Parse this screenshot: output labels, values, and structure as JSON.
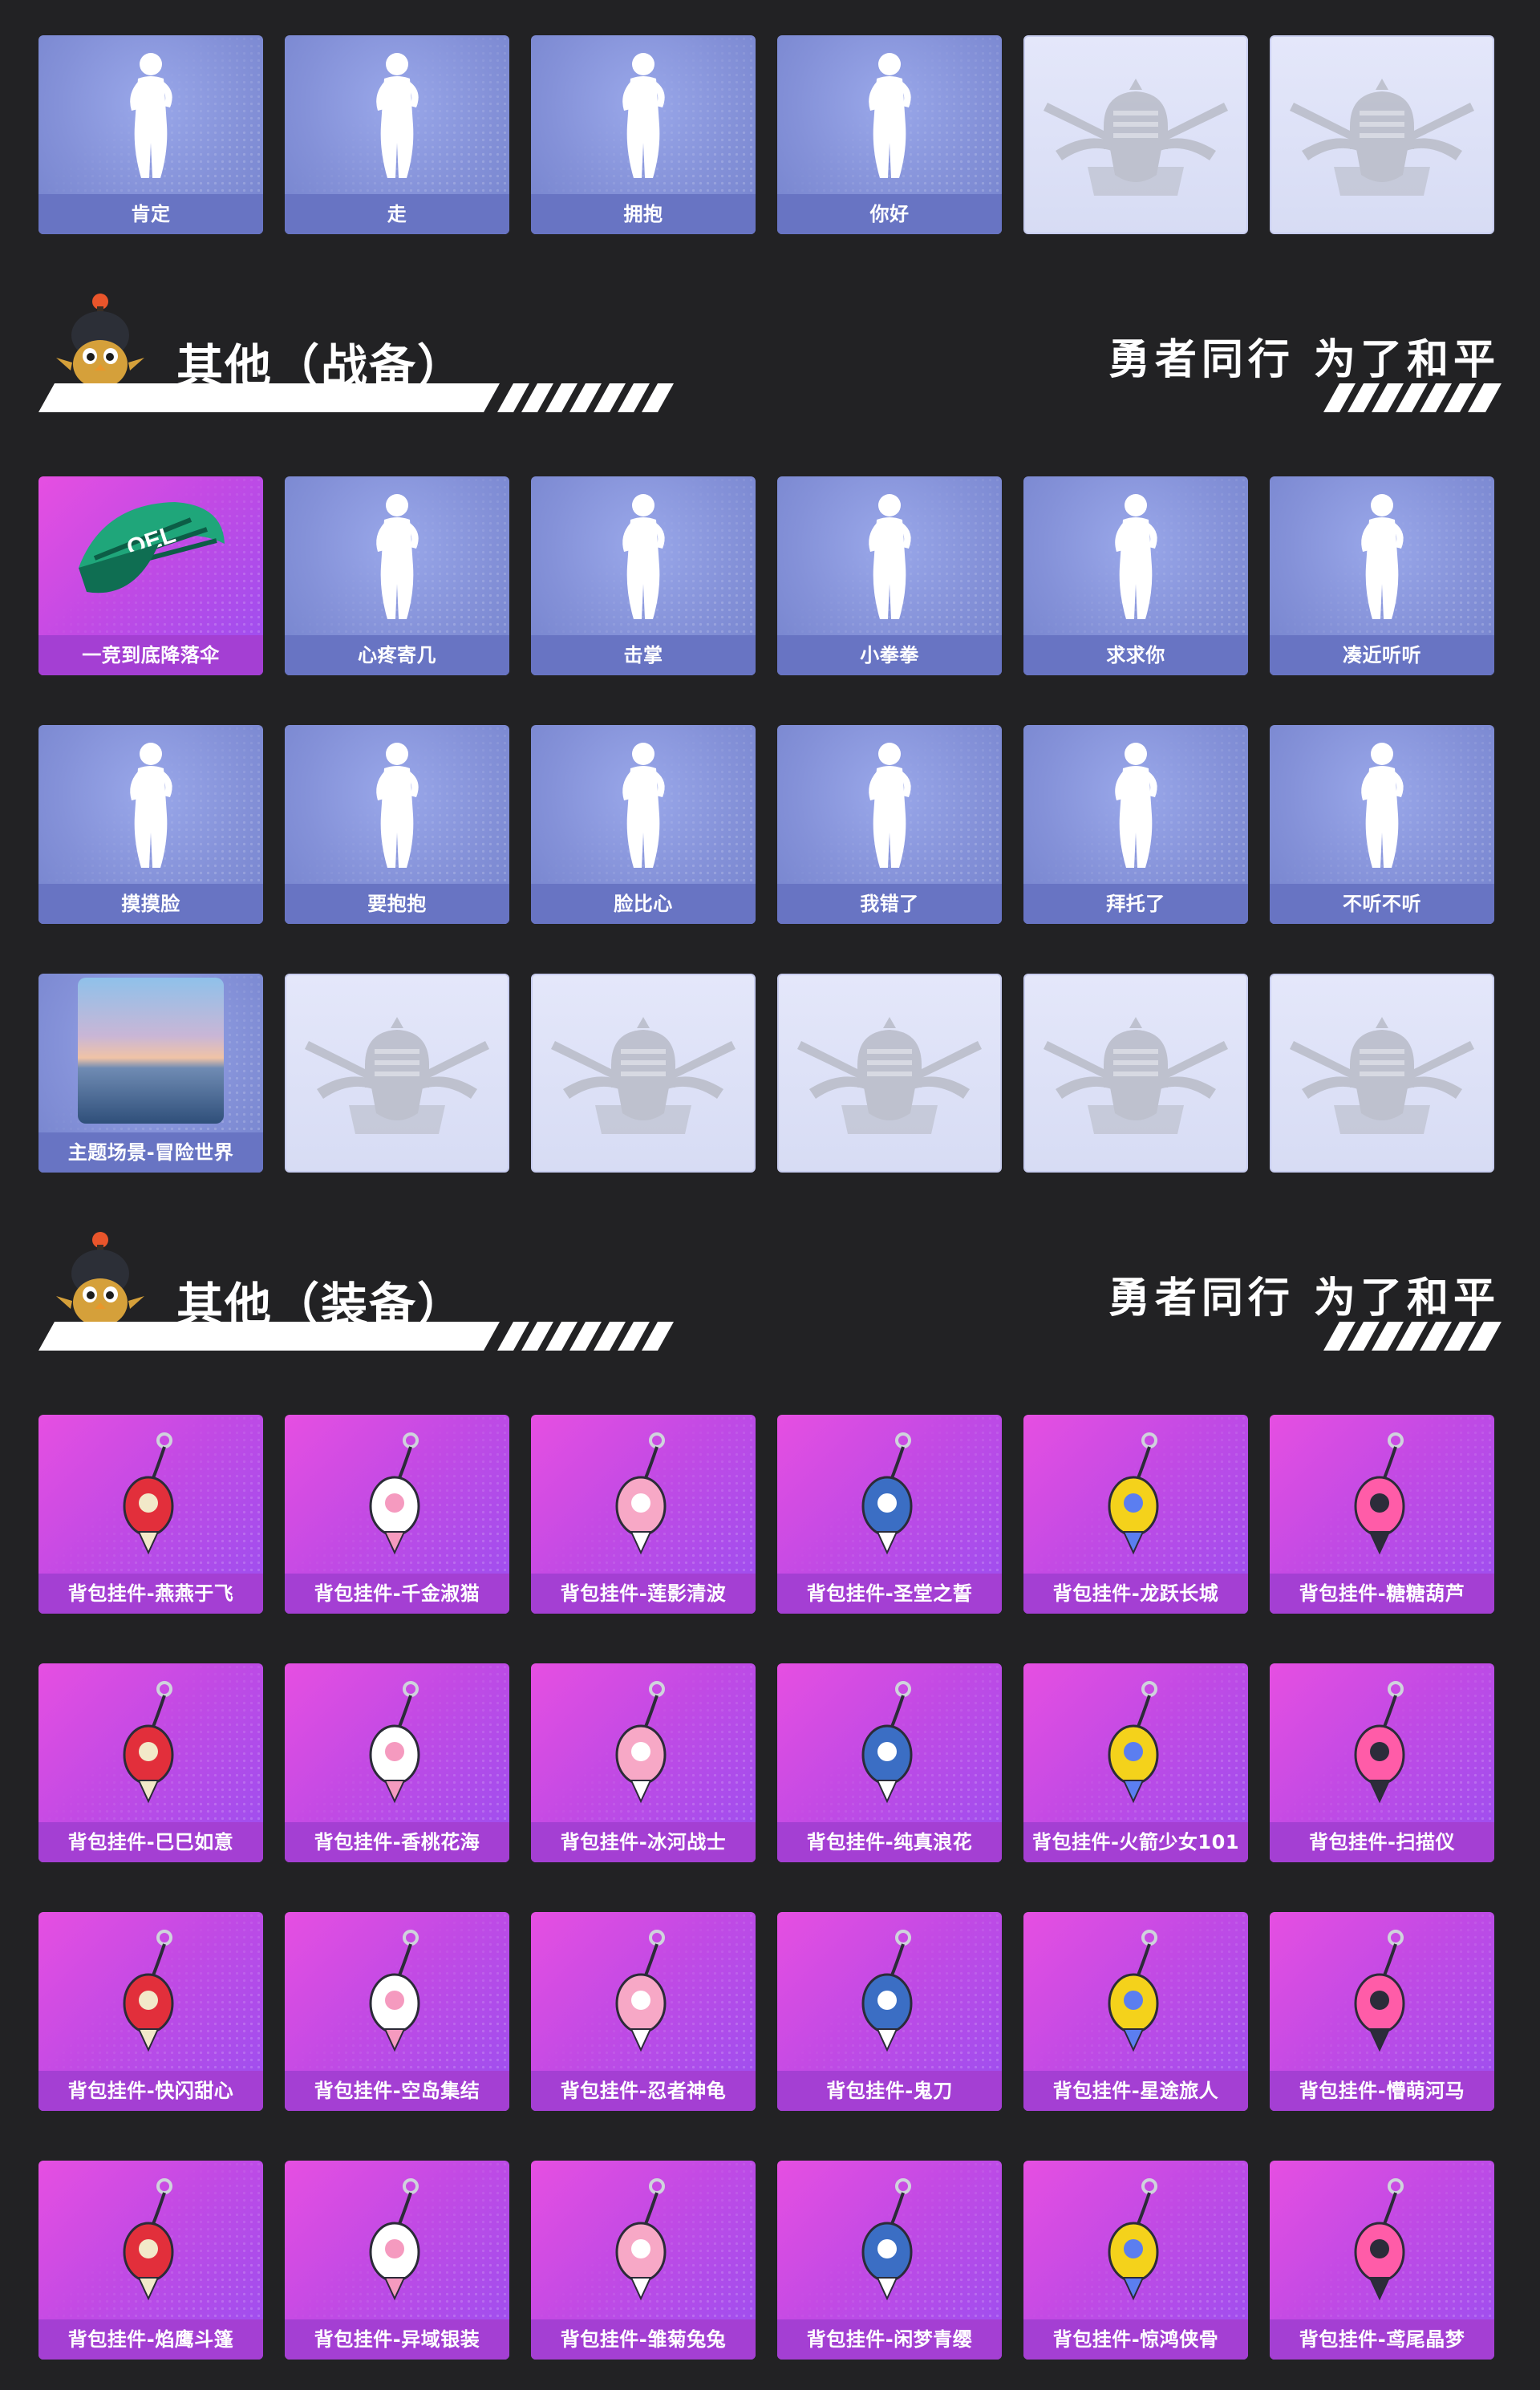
{
  "colors": {
    "background": "#222224",
    "card_blue": "#8491d8",
    "card_blue_label": "#6874c3",
    "card_purple": "#c24ae4",
    "card_purple_label": "#a43fd3",
    "card_locked": "#dde1f7"
  },
  "top_row": [
    {
      "label": "肯定",
      "style": "blue",
      "icon": "emote-affirm-icon"
    },
    {
      "label": "走",
      "style": "blue",
      "icon": "emote-go-pointing-icon"
    },
    {
      "label": "拥抱",
      "style": "blue",
      "icon": "emote-hug-icon"
    },
    {
      "label": "你好",
      "style": "blue",
      "icon": "emote-hello-wave-icon"
    },
    {
      "label": "",
      "style": "pale",
      "icon": "locked-emblem-icon"
    },
    {
      "label": "",
      "style": "pale",
      "icon": "locked-emblem-icon"
    }
  ],
  "sections": [
    {
      "title": "其他（战备）",
      "slogan": "勇者同行 为了和平",
      "rows": [
        [
          {
            "label": "一竞到底降落伞",
            "style": "purple",
            "icon": "parachute-icon"
          },
          {
            "label": "心疼寄几",
            "style": "blue",
            "icon": "emote-self-hug-icon"
          },
          {
            "label": "击掌",
            "style": "blue",
            "icon": "emote-high-five-icon"
          },
          {
            "label": "小拳拳",
            "style": "blue",
            "icon": "emote-little-fist-icon"
          },
          {
            "label": "求求你",
            "style": "blue",
            "icon": "emote-please-icon"
          },
          {
            "label": "凑近听听",
            "style": "blue",
            "icon": "emote-listen-icon"
          }
        ],
        [
          {
            "label": "摸摸脸",
            "style": "blue",
            "icon": "emote-touch-face-icon"
          },
          {
            "label": "要抱抱",
            "style": "blue",
            "icon": "emote-want-hug-icon"
          },
          {
            "label": "脸比心",
            "style": "blue",
            "icon": "emote-face-heart-icon"
          },
          {
            "label": "我错了",
            "style": "blue",
            "icon": "emote-sorry-icon"
          },
          {
            "label": "拜托了",
            "style": "blue",
            "icon": "emote-beg-icon"
          },
          {
            "label": "不听不听",
            "style": "blue",
            "icon": "emote-not-listening-icon"
          }
        ],
        [
          {
            "label": "主题场景-冒险世界",
            "style": "blue",
            "icon": "theme-scene-image"
          },
          {
            "label": "",
            "style": "pale",
            "icon": "locked-emblem-icon"
          },
          {
            "label": "",
            "style": "pale",
            "icon": "locked-emblem-icon"
          },
          {
            "label": "",
            "style": "pale",
            "icon": "locked-emblem-icon"
          },
          {
            "label": "",
            "style": "pale",
            "icon": "locked-emblem-icon"
          },
          {
            "label": "",
            "style": "pale",
            "icon": "locked-emblem-icon"
          }
        ]
      ]
    },
    {
      "title": "其他（装备）",
      "slogan": "勇者同行 为了和平",
      "rows": [
        [
          {
            "label": "背包挂件-燕燕于飞",
            "style": "purple",
            "icon": "pendant-swallow-icon"
          },
          {
            "label": "背包挂件-千金淑猫",
            "style": "purple",
            "icon": "pendant-cat-icon"
          },
          {
            "label": "背包挂件-莲影清波",
            "style": "purple",
            "icon": "pendant-lotus-icon"
          },
          {
            "label": "背包挂件-圣堂之誓",
            "style": "purple",
            "icon": "pendant-crystal-icon"
          },
          {
            "label": "背包挂件-龙跃长城",
            "style": "purple",
            "icon": "pendant-dragon-icon"
          },
          {
            "label": "背包挂件-糖糖葫芦",
            "style": "purple",
            "icon": "pendant-gourd-icon"
          }
        ],
        [
          {
            "label": "背包挂件-巳巳如意",
            "style": "purple",
            "icon": "pendant-snake-icon"
          },
          {
            "label": "背包挂件-香桃花海",
            "style": "purple",
            "icon": "pendant-peach-blossom-icon"
          },
          {
            "label": "背包挂件-冰河战士",
            "style": "purple",
            "icon": "pendant-ice-warrior-icon"
          },
          {
            "label": "背包挂件-纯真浪花",
            "style": "purple",
            "icon": "pendant-wave-icon"
          },
          {
            "label": "背包挂件-火箭少女101",
            "style": "purple",
            "icon": "pendant-rocket-icon"
          },
          {
            "label": "背包挂件-扫描仪",
            "style": "purple",
            "icon": "pendant-scanner-icon"
          }
        ],
        [
          {
            "label": "背包挂件-快闪甜心",
            "style": "purple",
            "icon": "pendant-donut-icon"
          },
          {
            "label": "背包挂件-空岛集结",
            "style": "purple",
            "icon": "pendant-pistol-icon"
          },
          {
            "label": "背包挂件-忍者神龟",
            "style": "purple",
            "icon": "pendant-shuriken-icon"
          },
          {
            "label": "背包挂件-鬼刀",
            "style": "purple",
            "icon": "pendant-blue-gem-icon"
          },
          {
            "label": "背包挂件-星途旅人",
            "style": "purple",
            "icon": "pendant-shuttle-icon"
          },
          {
            "label": "背包挂件-懵萌河马",
            "style": "purple",
            "icon": "pendant-heart-tassel-icon"
          }
        ],
        [
          {
            "label": "背包挂件-焰鹰斗篷",
            "style": "purple",
            "icon": "pendant-knot-icon"
          },
          {
            "label": "背包挂件-异域银装",
            "style": "purple",
            "icon": "pendant-wings-icon"
          },
          {
            "label": "背包挂件-雏菊兔兔",
            "style": "purple",
            "icon": "pendant-bunny-icon"
          },
          {
            "label": "背包挂件-闲梦青缨",
            "style": "purple",
            "icon": "pendant-tassel-icon"
          },
          {
            "label": "背包挂件-惊鸿侠骨",
            "style": "purple",
            "icon": "pendant-ring-tassel-icon"
          },
          {
            "label": "背包挂件-鸢尾晶梦",
            "style": "purple",
            "icon": "pendant-lantern-icon"
          }
        ]
      ]
    }
  ]
}
